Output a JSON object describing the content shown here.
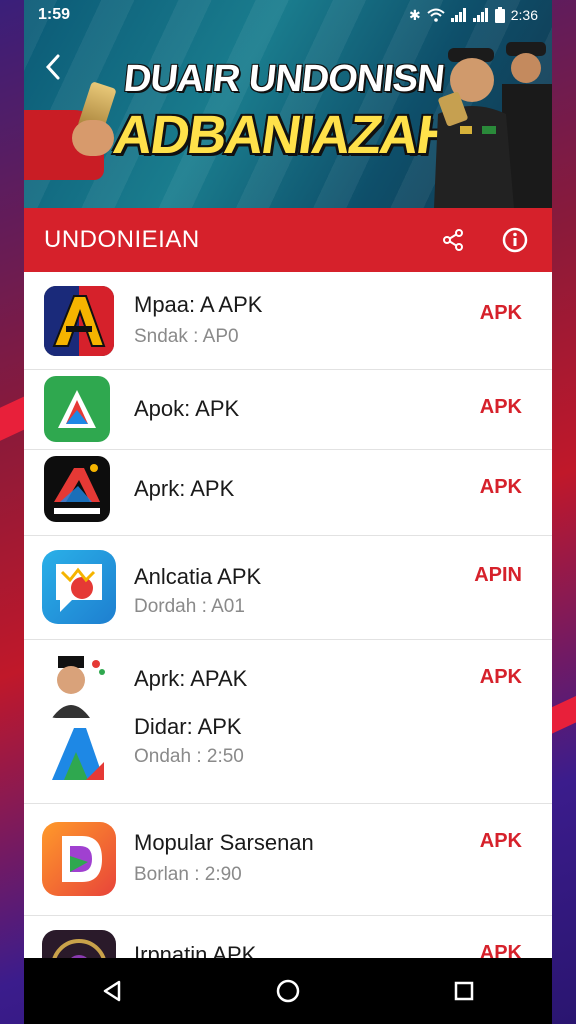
{
  "status_bar": {
    "time": "1:59",
    "right_time": "2:36"
  },
  "banner": {
    "title_line1": "DUAIR UNDONISN",
    "title_line2": "ADBANIAZAH"
  },
  "header": {
    "title": "UNDONIEIAN",
    "share_icon": "share-icon",
    "info_icon": "info-icon"
  },
  "apps": [
    {
      "name": "Mpaa: A APK",
      "sub": "Sndak : AP0",
      "badge": "APK",
      "icon": "red-blue-a-icon"
    },
    {
      "name": "Apok: APK",
      "sub": "",
      "badge": "APK",
      "icon": "green-play-icon"
    },
    {
      "name": "Aprk: APK",
      "sub": "",
      "badge": "APK",
      "icon": "black-a-logo-icon"
    },
    {
      "name": "Anlcatia APK",
      "sub": "Dordah : A01",
      "badge": "APIN",
      "icon": "chat-bubble-icon"
    },
    {
      "name": "Aprk: APAK",
      "sub": "",
      "badge": "APK",
      "icon": "character-avatar-icon"
    },
    {
      "name": "Didar: APK",
      "sub": "Ondah : 2:50",
      "badge": "",
      "icon": "blue-a-icon"
    },
    {
      "name": "Mopular Sarsenan",
      "sub": "Borlan : 2:90",
      "badge": "APK",
      "icon": "orange-d-icon"
    },
    {
      "name": "Irpnatin APK",
      "sub": "",
      "badge": "APK",
      "icon": "dark-game-icon"
    }
  ],
  "colors": {
    "accent_red": "#d6212b",
    "banner_teal": "#0b5a76",
    "title_yellow": "#ffe14a"
  }
}
